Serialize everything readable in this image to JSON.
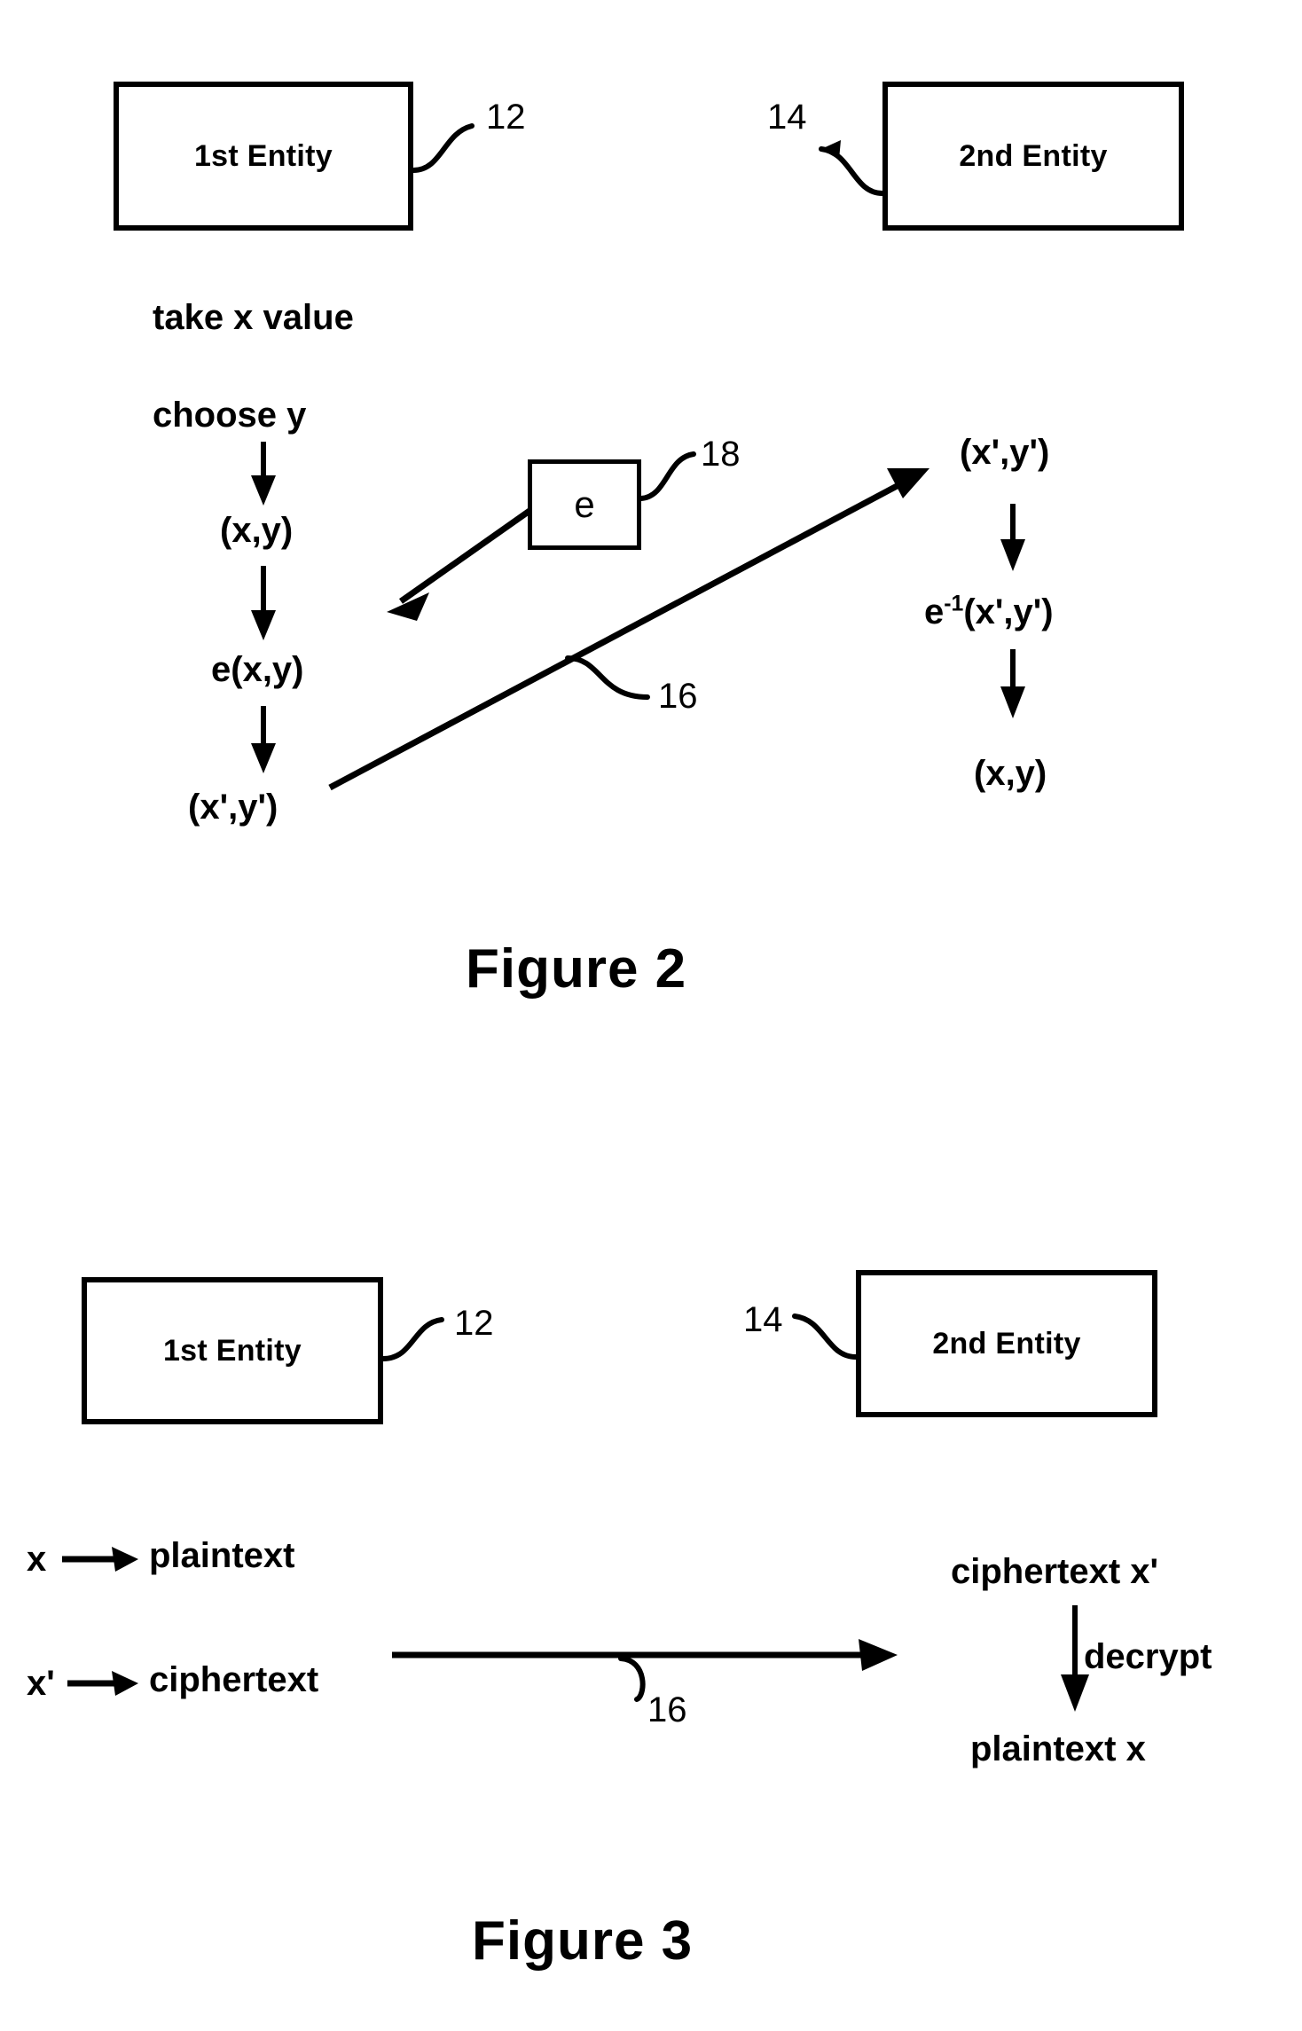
{
  "document": {
    "type": "patent-drawing-sheet",
    "figures": [
      {
        "id": "figure-2",
        "caption": "Figure 2",
        "entities": [
          {
            "label": "1st Entity",
            "numeral": "12"
          },
          {
            "label": "2nd Entity",
            "numeral": "14"
          }
        ],
        "operator_box": {
          "label": "e",
          "numeral": "18"
        },
        "channel": {
          "numeral": "16"
        },
        "left_flow": [
          "take x value",
          "choose y",
          "(x,y)",
          "e(x,y)",
          "(x',y')"
        ],
        "right_flow": [
          "(x',y')",
          "e-1(x',y')",
          "(x,y)"
        ],
        "right_flow_parts": {
          "einv_base": "e",
          "einv_sup": "-1",
          "einv_args": "(x',y')"
        }
      },
      {
        "id": "figure-3",
        "caption": "Figure 3",
        "entities": [
          {
            "label": "1st Entity",
            "numeral": "12"
          },
          {
            "label": "2nd Entity",
            "numeral": "14"
          }
        ],
        "channel": {
          "numeral": "16"
        },
        "left_mappings": [
          {
            "symbol": "x",
            "arrow": "→",
            "meaning": "plaintext"
          },
          {
            "symbol": "x'",
            "arrow": "→",
            "meaning": "ciphertext"
          }
        ],
        "right_flow": {
          "input": "ciphertext x'",
          "operation": "decrypt",
          "output": "plaintext x"
        }
      }
    ]
  },
  "colors": {
    "ink": "#000000",
    "paper": "#ffffff"
  }
}
